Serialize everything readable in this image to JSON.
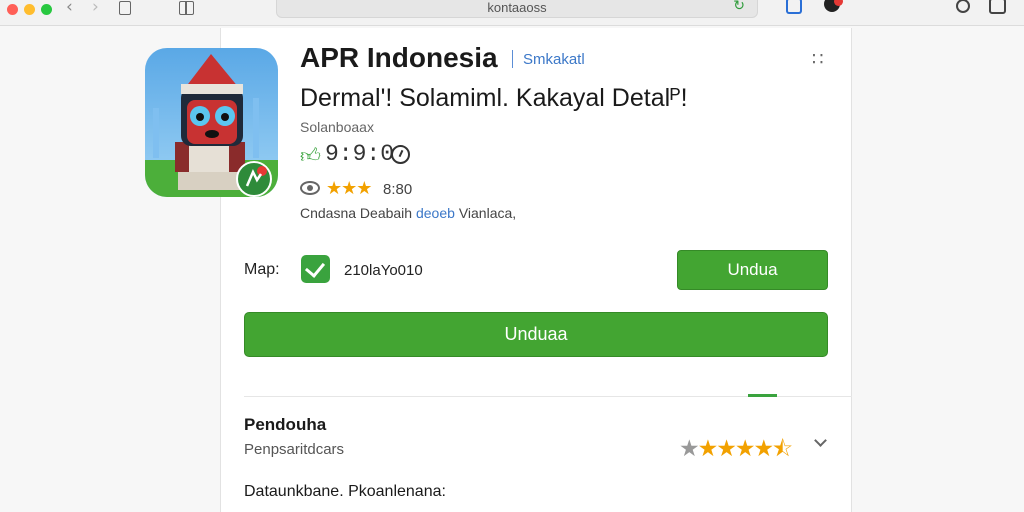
{
  "browser": {
    "url": "kontaaoss",
    "colors": {
      "accent": "#2e9c3a",
      "link": "#2a6fd6"
    }
  },
  "app": {
    "name": "APR Indonesia",
    "developer": "Smkakatl",
    "subtitle": "Dermal'! Solamiml. Kakayal Detalᴾ!",
    "category": "Solanboaax",
    "score": "9:9:0",
    "rating_count": "8:80",
    "description_plain": "Cndasna Deabaih",
    "description_link": "deoeb",
    "description_tail": "Vianlaca,",
    "stars_small": 3
  },
  "install": {
    "map_label": "Map:",
    "version": "210laYo010",
    "small_button": "Undua",
    "big_button": "Unduaa"
  },
  "section": {
    "title": "Pendouha",
    "subtitle": "Penpsaritdcars",
    "rating": 4.5,
    "footer": "Dataunkbane.  Pkoanlenana:"
  },
  "colors": {
    "button_green": "#43a532",
    "star": "#f2a100",
    "link": "#3c78c8"
  }
}
